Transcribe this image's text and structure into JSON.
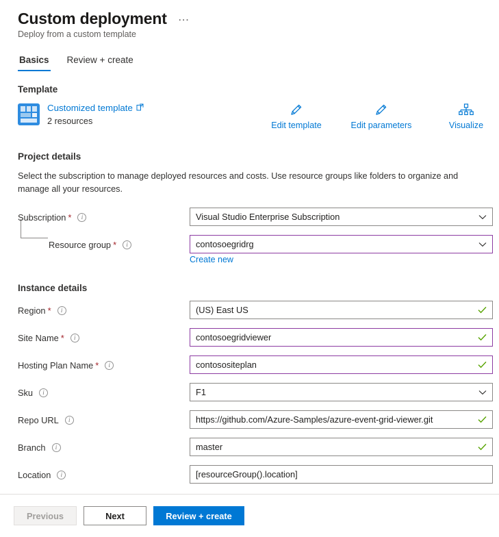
{
  "header": {
    "title": "Custom deployment",
    "subtitle": "Deploy from a custom template",
    "menu_icon": "…"
  },
  "tabs": [
    {
      "label": "Basics",
      "active": true
    },
    {
      "label": "Review + create",
      "active": false
    }
  ],
  "template": {
    "heading": "Template",
    "link_label": "Customized template",
    "resource_count": "2 resources",
    "actions": [
      {
        "label": "Edit template",
        "icon": "pencil-icon"
      },
      {
        "label": "Edit parameters",
        "icon": "pencil-icon"
      },
      {
        "label": "Visualize",
        "icon": "hierarchy-icon"
      }
    ]
  },
  "project_details": {
    "heading": "Project details",
    "description": "Select the subscription to manage deployed resources and costs. Use resource groups like folders to organize and manage all your resources.",
    "fields": [
      {
        "label": "Subscription",
        "required": true,
        "value": "Visual Studio Enterprise Subscription",
        "type": "select",
        "state": "default"
      },
      {
        "label": "Resource group",
        "required": true,
        "value": "contosoegridrg",
        "type": "select",
        "state": "modified"
      }
    ],
    "create_new_label": "Create new"
  },
  "instance_details": {
    "heading": "Instance details",
    "fields": [
      {
        "label": "Region",
        "required": true,
        "value": "(US) East US",
        "type": "text",
        "state": "default",
        "valid": true
      },
      {
        "label": "Site Name",
        "required": true,
        "value": "contosoegridviewer",
        "type": "text",
        "state": "modified",
        "valid": true
      },
      {
        "label": "Hosting Plan Name",
        "required": true,
        "value": "contosositeplan",
        "type": "text",
        "state": "modified",
        "valid": true
      },
      {
        "label": "Sku",
        "required": false,
        "value": "F1",
        "type": "select",
        "state": "default",
        "valid": false
      },
      {
        "label": "Repo URL",
        "required": false,
        "value": "https://github.com/Azure-Samples/azure-event-grid-viewer.git",
        "type": "text",
        "state": "default",
        "valid": true
      },
      {
        "label": "Branch",
        "required": false,
        "value": "master",
        "type": "text",
        "state": "default",
        "valid": true
      },
      {
        "label": "Location",
        "required": false,
        "value": "[resourceGroup().location]",
        "type": "text",
        "state": "default",
        "valid": false
      }
    ]
  },
  "footer": {
    "previous_label": "Previous",
    "next_label": "Next",
    "review_label": "Review + create"
  },
  "colors": {
    "accent": "#0078d4",
    "modified_border": "#8c3ba2",
    "valid_check": "#57a300",
    "required_star": "#a4262c"
  }
}
